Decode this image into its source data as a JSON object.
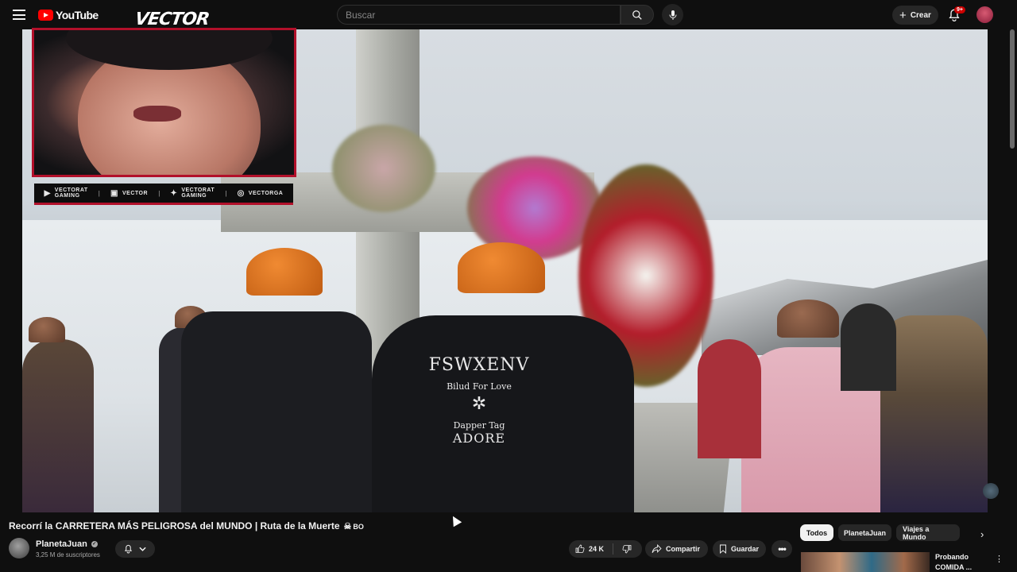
{
  "header": {
    "brand": "YouTube",
    "search_placeholder": "Buscar",
    "create_label": "Crear",
    "notification_badge": "9+"
  },
  "overlay": {
    "vector_logo": "VECTOR",
    "social": [
      {
        "line1": "VECTORAT",
        "line2": "GAMING",
        "icon": "youtube-icon"
      },
      {
        "line1": "VECTOR",
        "line2": "",
        "icon": "twitch-icon"
      },
      {
        "line1": "VECTORAT",
        "line2": "GAMING",
        "icon": "twitter-icon"
      },
      {
        "line1": "VECTORGA",
        "line2": "",
        "icon": "instagram-icon"
      }
    ]
  },
  "video_content": {
    "jacket_line1": "FSWXENV",
    "jacket_line2": "Bilud For Love",
    "jacket_line3": "Dapper Tag",
    "jacket_line4": "ADORE"
  },
  "video": {
    "title": "Recorrí la CARRETERA MÁS PELIGROSA del MUNDO | Ruta de la Muerte",
    "title_suffix": "BO"
  },
  "channel": {
    "name": "PlanetaJuan",
    "subscribers": "3,25 M de suscriptores"
  },
  "actions": {
    "like_count": "24 K",
    "share_label": "Compartir",
    "save_label": "Guardar"
  },
  "chips": [
    "Todos",
    "PlanetaJuan",
    "Viajes a Mundo"
  ],
  "recommendation": {
    "title": "Probando COMIDA ..."
  },
  "colors": {
    "background": "#0f0f0f",
    "overlay_accent": "#b2102a",
    "brand_red": "#ff0000"
  }
}
